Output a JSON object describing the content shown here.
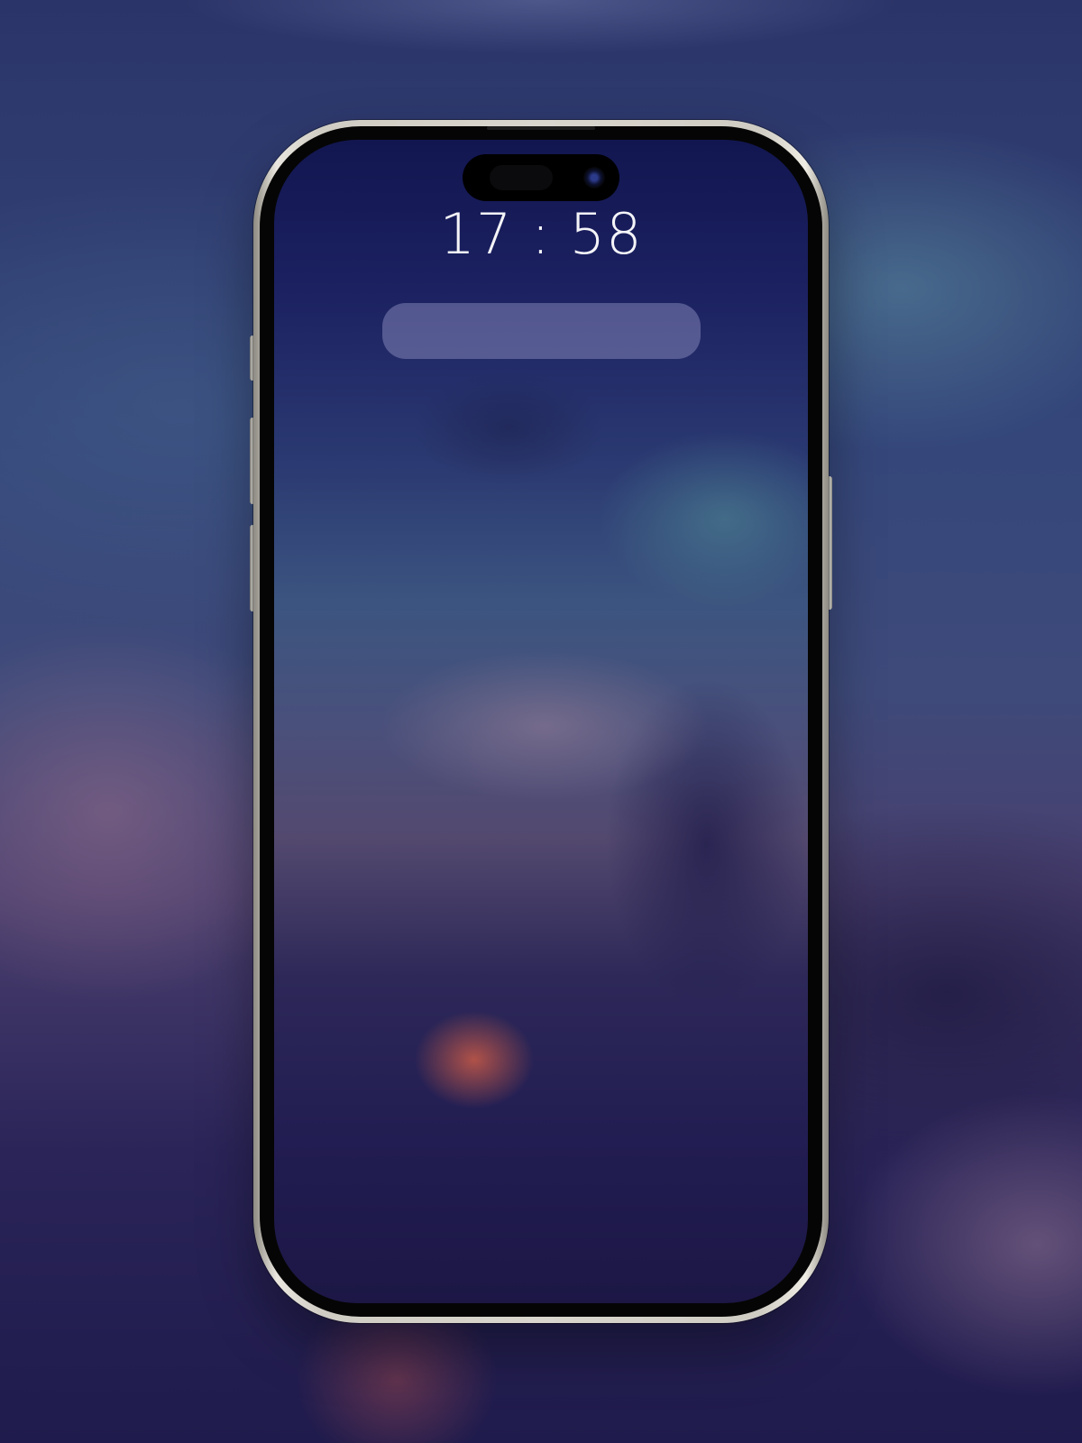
{
  "lock_screen": {
    "time": "17 : 58"
  },
  "icons": {
    "camera": "front-camera-icon"
  }
}
